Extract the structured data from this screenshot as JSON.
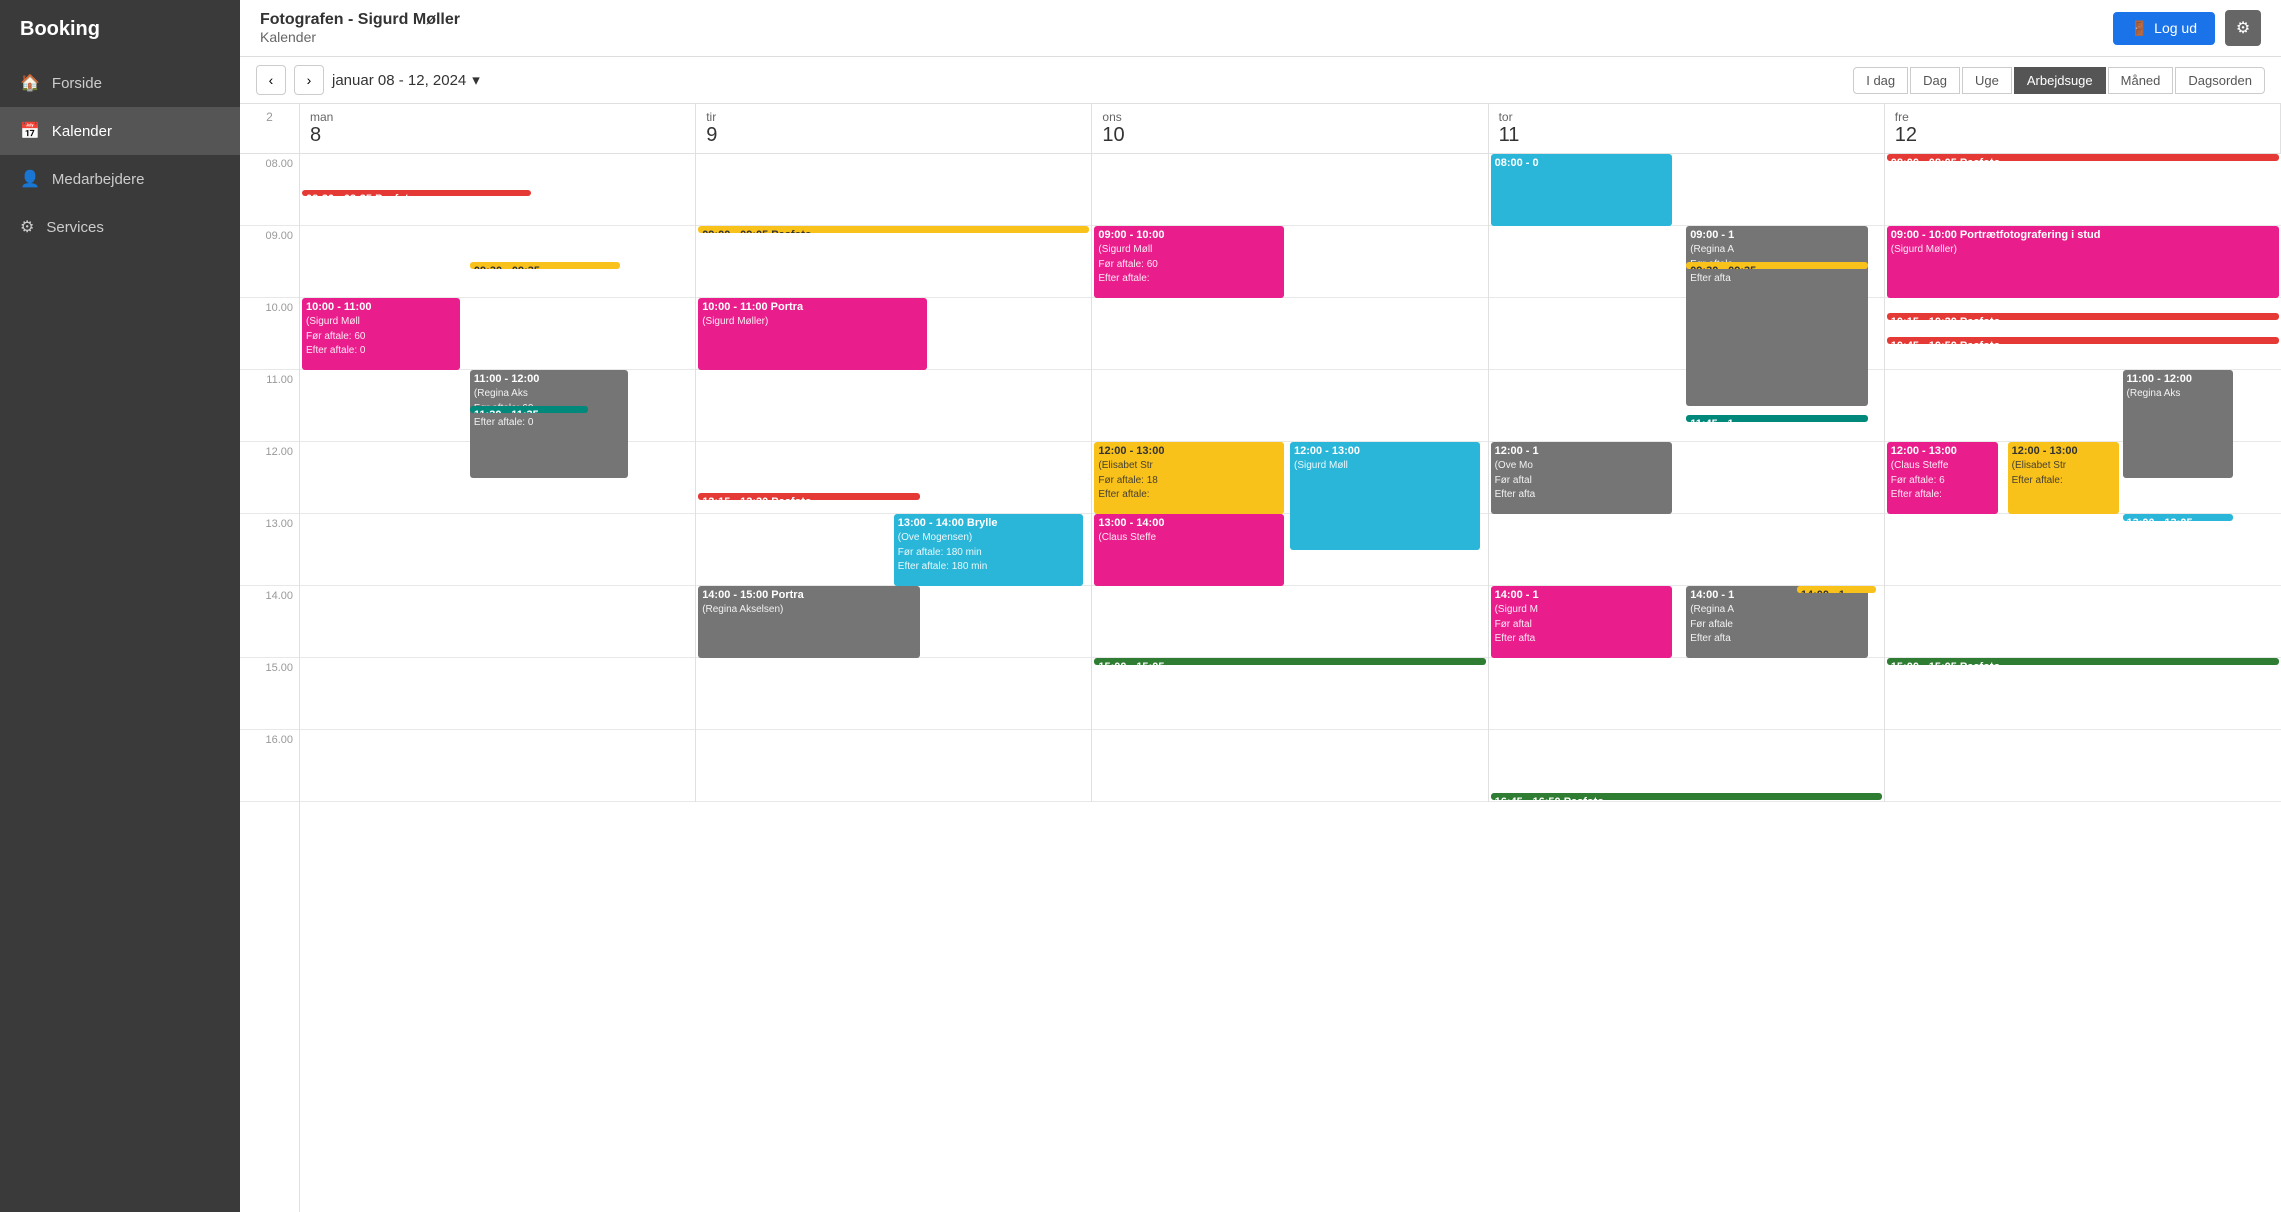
{
  "sidebar": {
    "title": "Booking",
    "items": [
      {
        "id": "forside",
        "label": "Forside",
        "icon": "🏠"
      },
      {
        "id": "kalender",
        "label": "Kalender",
        "icon": "📅",
        "active": true
      },
      {
        "id": "medarbejdere",
        "label": "Medarbejdere",
        "icon": "👤"
      },
      {
        "id": "services",
        "label": "Services",
        "icon": "⚙"
      }
    ]
  },
  "header": {
    "app_name": "Fotografen - Sigurd Møller",
    "app_sub": "Kalender",
    "log_out_label": "Log ud",
    "settings_icon": "⚙"
  },
  "toolbar": {
    "date_range": "januar 08 - 12, 2024",
    "today_label": "I dag",
    "dag_label": "Dag",
    "uge_label": "Uge",
    "arbejdsuge_label": "Arbejdsuge",
    "maaned_label": "Måned",
    "dagsorden_label": "Dagsorden",
    "active_view": "Arbejdsuge"
  },
  "calendar": {
    "week_num": "2",
    "days": [
      {
        "name": "man",
        "num": "8"
      },
      {
        "name": "tir",
        "num": "9"
      },
      {
        "name": "ons",
        "num": "10"
      },
      {
        "name": "tor",
        "num": "11"
      },
      {
        "name": "fre",
        "num": "12"
      }
    ],
    "time_slots": [
      "08.00",
      "09.00",
      "10.00",
      "11.00",
      "12.00",
      "13.00",
      "14.00",
      "15.00",
      "16.00"
    ]
  }
}
